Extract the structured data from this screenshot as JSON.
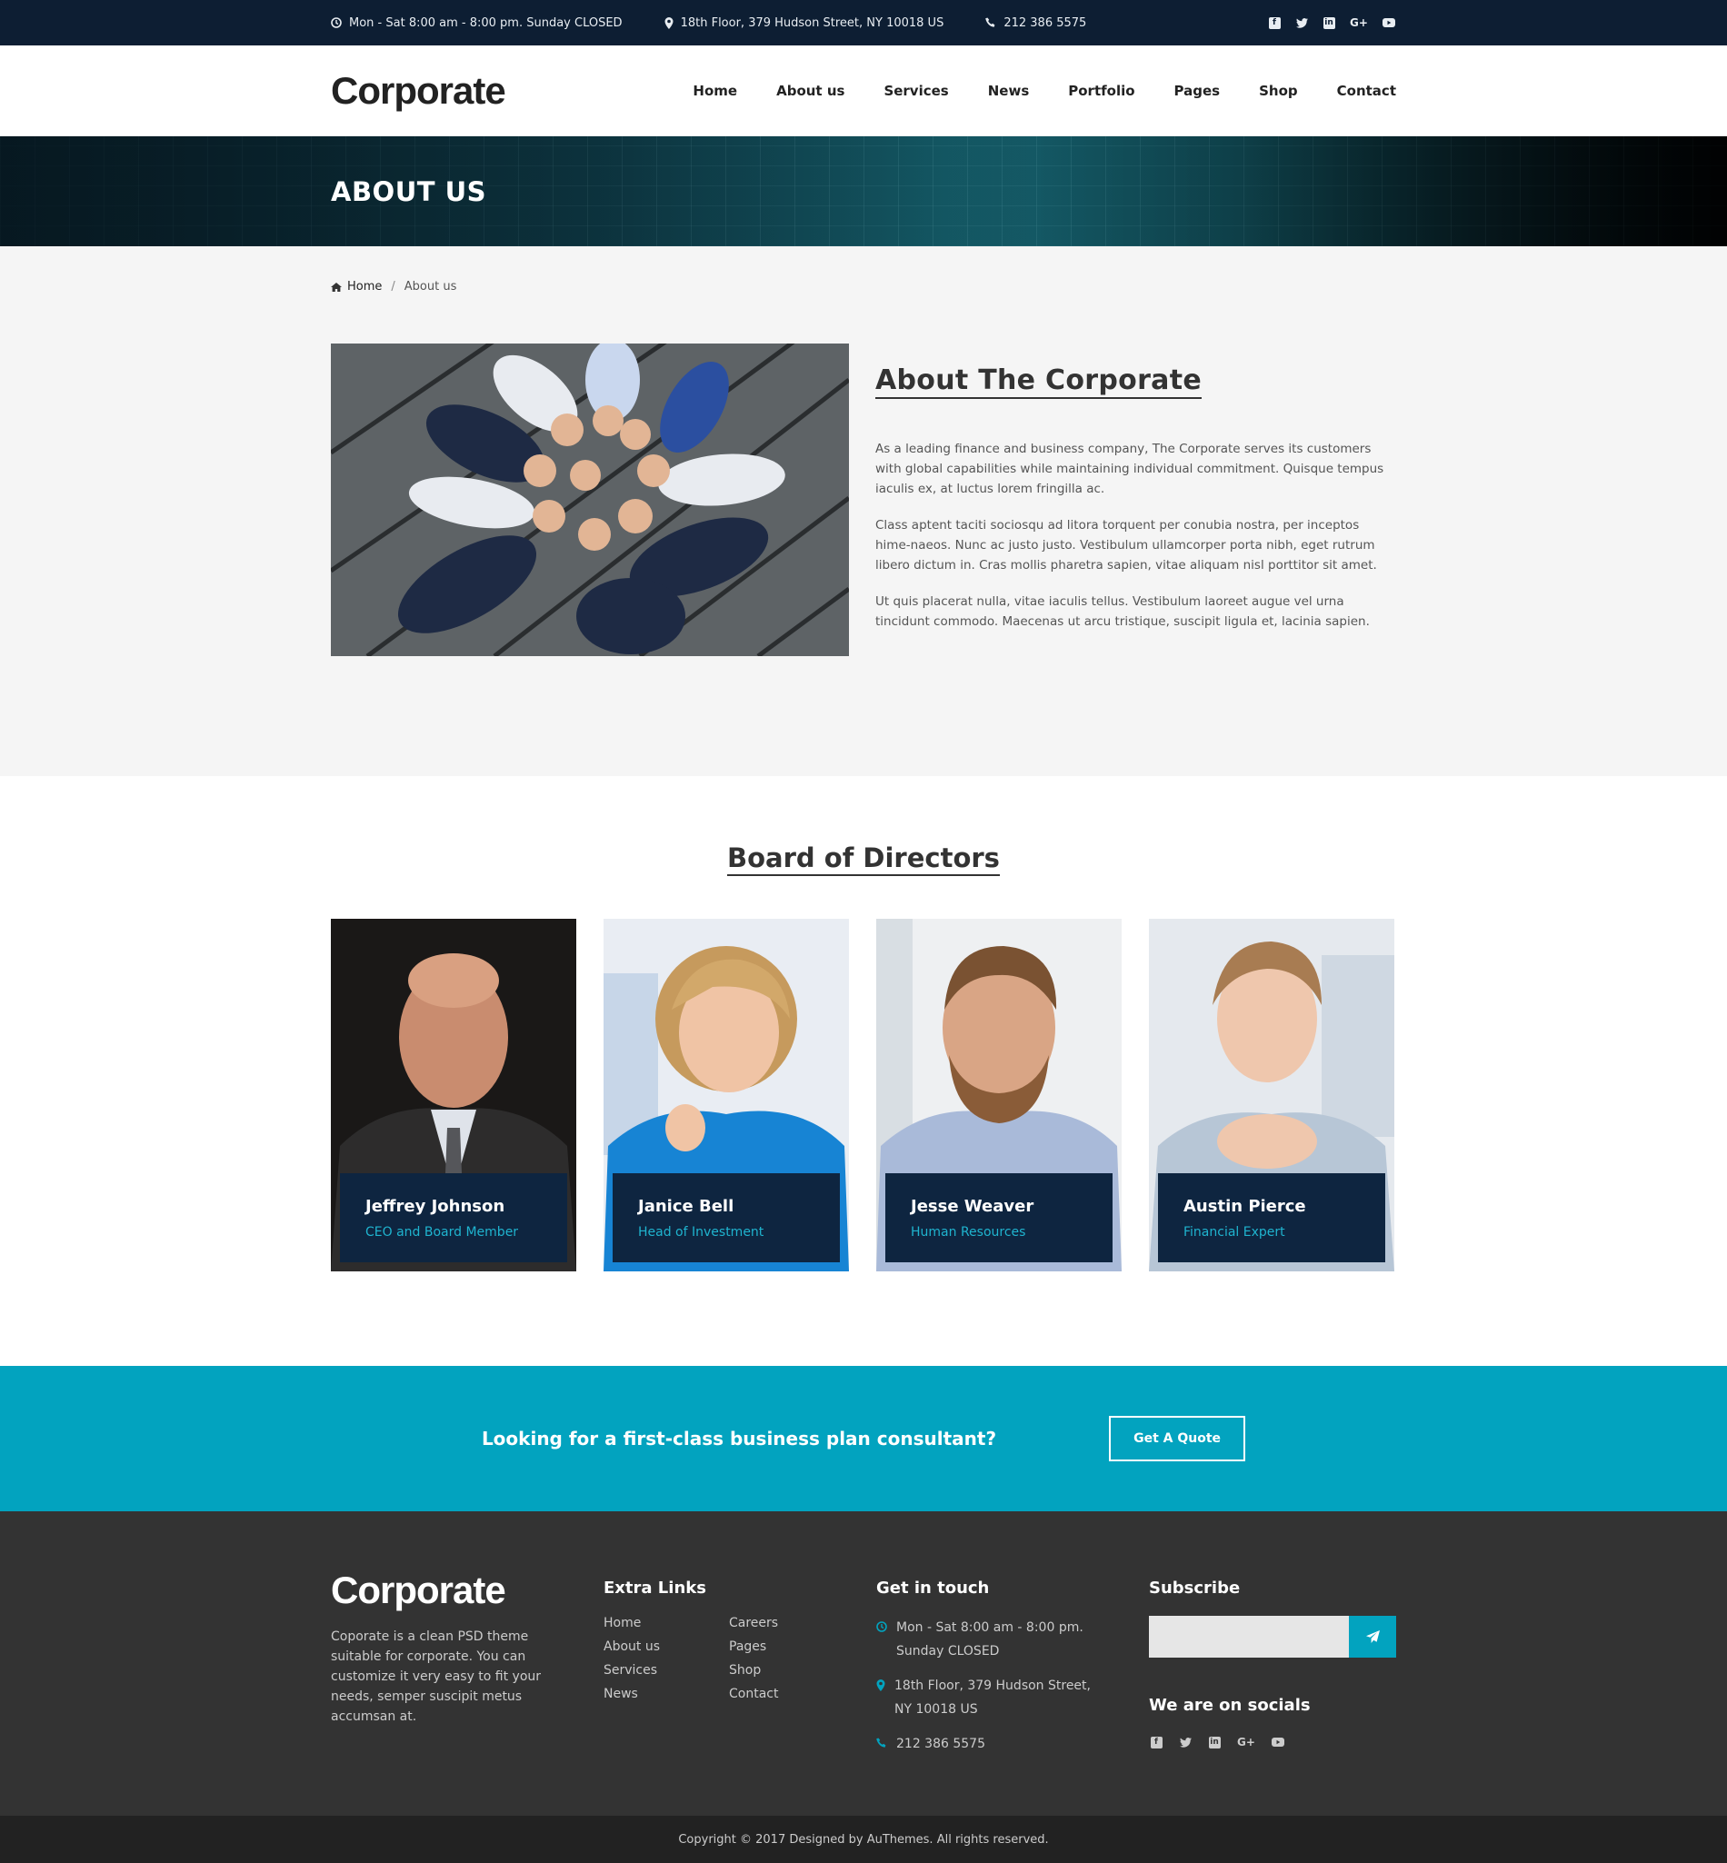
{
  "topbar": {
    "hours": "Mon - Sat 8:00 am - 8:00 pm. Sunday CLOSED",
    "address": "18th Floor, 379 Hudson Street, NY 10018 US",
    "phone": "212 386 5575",
    "socials": [
      "facebook-icon",
      "twitter-icon",
      "linkedin-icon",
      "google-plus-icon",
      "youtube-icon"
    ]
  },
  "header": {
    "logo": "Corporate",
    "nav": [
      "Home",
      "About us",
      "Services",
      "News",
      "Portfolio",
      "Pages",
      "Shop",
      "Contact"
    ]
  },
  "banner": {
    "title": "ABOUT US"
  },
  "breadcrumb": {
    "home": "Home",
    "separator": "/",
    "current": "About us"
  },
  "about": {
    "title": "About The Corporate",
    "paragraphs": [
      "As a leading finance and business company, The Corporate serves its customers with global capabilities while maintaining individual commitment. Quisque tempus iaculis ex, at luctus lorem fringilla ac.",
      "Class aptent taciti sociosqu ad litora torquent per conubia nostra, per inceptos hime-naeos. Nunc ac justo justo. Vestibulum ullamcorper porta nibh, eget rutrum libero dictum in. Cras mollis pharetra sapien, vitae aliquam nisl porttitor sit amet.",
      "Ut quis placerat nulla, vitae iaculis tellus. Vestibulum laoreet augue vel urna tincidunt commodo. Maecenas ut arcu tristique, suscipit ligula et, lacinia sapien."
    ]
  },
  "board": {
    "title": "Board of Directors",
    "members": [
      {
        "name": "Jeffrey Johnson",
        "role": "CEO and Board Member"
      },
      {
        "name": "Janice Bell",
        "role": "Head of Investment"
      },
      {
        "name": "Jesse Weaver",
        "role": "Human Resources"
      },
      {
        "name": "Austin Pierce",
        "role": "Financial Expert"
      }
    ]
  },
  "cta": {
    "message": "Looking for a first-class business plan consultant?",
    "button": "Get A Quote"
  },
  "footer": {
    "logo": "Corporate",
    "description": "Coporate is a clean PSD theme suitable for corporate. You can customize it very easy to fit your needs, semper suscipit metus accumsan at.",
    "extra_links_title": "Extra Links",
    "links": [
      "Home",
      "Careers",
      "About us",
      "Pages",
      "Services",
      "Shop",
      "News",
      "Contact"
    ],
    "get_in_touch_title": "Get in touch",
    "hours": "Mon - Sat 8:00 am - 8:00 pm. Sunday CLOSED",
    "address": "18th Floor, 379 Hudson Street, NY 10018 US",
    "phone": "212 386 5575",
    "subscribe_title": "Subscribe",
    "subscribe_placeholder": "",
    "socials_title": "We are on socials",
    "copyright": "Copyright © 2017 Designed by AuThemes. All rights reserved."
  },
  "colors": {
    "accent": "#02a3bf",
    "navy": "#0d1e33",
    "footer": "#333333"
  }
}
